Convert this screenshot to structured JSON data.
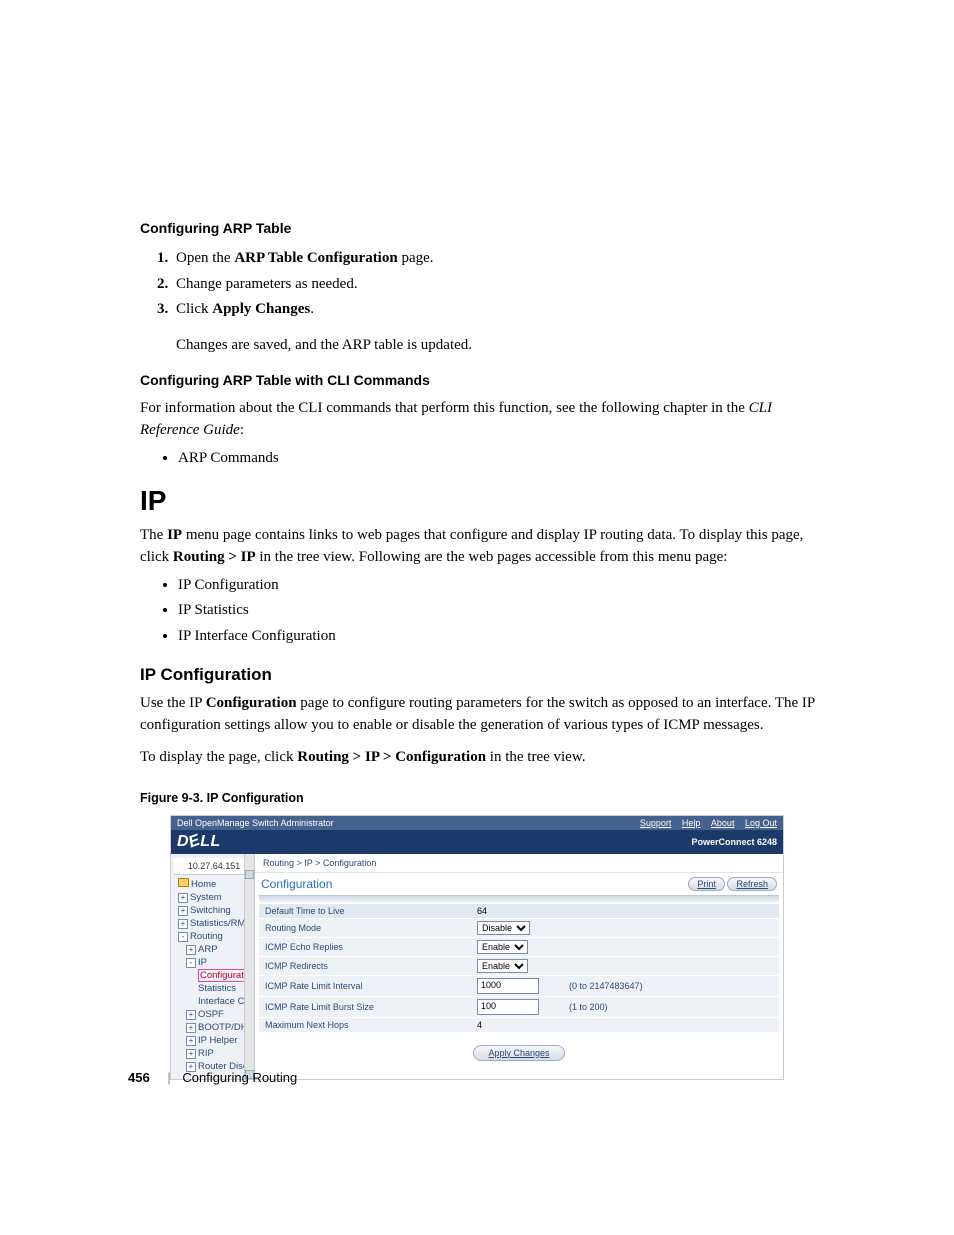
{
  "h4a": "Configuring ARP Table",
  "steps": {
    "s1a": "Open the ",
    "s1b": "ARP Table Configuration",
    "s1c": " page.",
    "s2": "Change parameters as needed.",
    "s3a": "Click ",
    "s3b": "Apply Changes",
    "s3c": "."
  },
  "result": "Changes are saved, and the ARP table is updated.",
  "h4b": "Configuring ARP Table with CLI Commands",
  "cliPara1": "For information about the CLI commands that perform this function, see the following chapter in the ",
  "cliGuide": "CLI Reference Guide",
  "colon": ":",
  "cliBullet": "ARP Commands",
  "h1": "IP",
  "ipIntro1": "The ",
  "ipIntroBold": "IP",
  "ipIntro2": " menu page contains links to web pages that configure and display IP routing data. To display this page, click ",
  "ipNav": "Routing > IP",
  "ipIntro3": " in the tree view. Following are the web pages accessible from this menu page:",
  "ipBullets": {
    "b1": "IP Configuration",
    "b2": "IP Statistics",
    "b3": "IP Interface Configuration"
  },
  "h3": "IP Configuration",
  "ipCfg1a": "Use the IP ",
  "ipCfg1b": "Configuration",
  "ipCfg1c": " page to configure routing parameters for the switch as opposed to an interface. The IP configuration settings allow you to enable or disable the generation of various types of ICMP messages.",
  "ipCfg2a": "To display the page, click ",
  "ipCfg2b": "Routing > IP > Configuration",
  "ipCfg2c": " in the tree view.",
  "figCaption": "Figure 9-3.    IP Configuration",
  "footer": {
    "page": "456",
    "title": "Configuring Routing"
  },
  "shot": {
    "topbarLeft": "Dell OpenManage Switch Administrator",
    "topbarLinks": {
      "support": "Support",
      "help": "Help",
      "about": "About",
      "logout": "Log Out"
    },
    "product": "PowerConnect 6248",
    "navIp": "10.27.64.151",
    "nav": {
      "home": "Home",
      "system": "System",
      "switching": "Switching",
      "stats": "Statistics/RMON",
      "routing": "Routing",
      "arp": "ARP",
      "ip": "IP",
      "cfg": "Configuration",
      "ipstats": "Statistics",
      "ifcfg": "Interface Config",
      "ospf": "OSPF",
      "bootp": "BOOTP/DHCP Rel",
      "iphelper": "IP Helper",
      "rip": "RIP",
      "rdisc": "Router Discovery"
    },
    "crumb": "Routing > IP > Configuration",
    "panelTitle": "Configuration",
    "btnPrint": "Print",
    "btnRefresh": "Refresh",
    "params": {
      "ttlLabel": "Default Time to Live",
      "ttlVal": "64",
      "rmLabel": "Routing Mode",
      "rmVal": "Disable",
      "echoLabel": "ICMP Echo Replies",
      "echoVal": "Enable",
      "redirLabel": "ICMP Redirects",
      "redirVal": "Enable",
      "rliLabel": "ICMP Rate Limit Interval",
      "rliVal": "1000",
      "rliRange": "(0 to 2147483647)",
      "rlbLabel": "ICMP Rate Limit Burst Size",
      "rlbVal": "100",
      "rlbRange": "(1 to 200)",
      "mnhLabel": "Maximum Next Hops",
      "mnhVal": "4"
    },
    "apply": "Apply Changes"
  }
}
